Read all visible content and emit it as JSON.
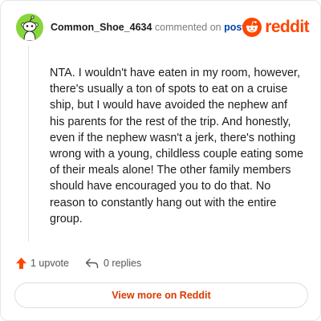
{
  "comment": {
    "author": "Common_Shoe_4634",
    "action_text": "commented on",
    "post_link": "post",
    "body": "NTA. I wouldn't have eaten in my room, however, there's usually a ton of spots to eat on a cruise ship, but I would have avoided the nephew anf his parents for the rest of the trip. And honestly, even if the nephew wasn't a jerk, there's nothing wrong with a young, childless couple eating some of their meals alone! The other family members should have encouraged you to do that. No reason to constantly hang out with the entire group."
  },
  "brand": {
    "wordmark": "reddit",
    "color": "#ff4500"
  },
  "actions": {
    "upvote_label": "1 upvote",
    "replies_label": "0 replies"
  },
  "footer": {
    "view_more_label": "View more on Reddit"
  },
  "icons": {
    "avatar": "snoo-avatar-icon",
    "brand": "reddit-logo-icon",
    "upvote": "upvote-arrow-icon",
    "reply": "reply-arrow-icon"
  }
}
